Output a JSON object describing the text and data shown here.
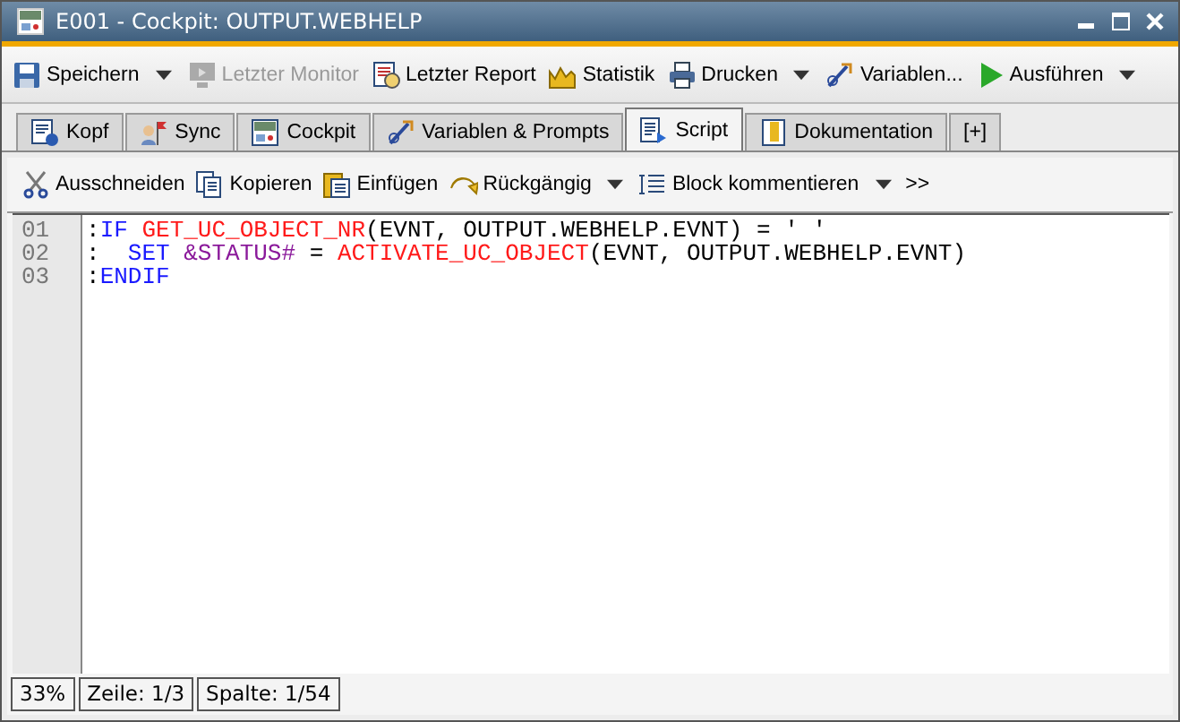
{
  "window": {
    "title": "E001 - Cockpit: OUTPUT.WEBHELP"
  },
  "toolbar": [
    {
      "label": "Speichern",
      "kind": "save",
      "disabled": false,
      "dropdown": true
    },
    {
      "label": "Letzter Monitor",
      "kind": "monitor",
      "disabled": true,
      "dropdown": false
    },
    {
      "label": "Letzter Report",
      "kind": "report",
      "disabled": false,
      "dropdown": false
    },
    {
      "label": "Statistik",
      "kind": "chart",
      "disabled": false,
      "dropdown": false
    },
    {
      "label": "Drucken",
      "kind": "print",
      "disabled": false,
      "dropdown": true
    },
    {
      "label": "Variablen...",
      "kind": "vars",
      "disabled": false,
      "dropdown": false
    },
    {
      "label": "Ausführen",
      "kind": "play",
      "disabled": false,
      "dropdown": true
    }
  ],
  "tabs": [
    {
      "label": "Kopf",
      "kind": "doc",
      "selected": false
    },
    {
      "label": "Sync",
      "kind": "flag",
      "selected": false
    },
    {
      "label": "Cockpit",
      "kind": "window",
      "selected": false
    },
    {
      "label": "Variablen & Prompts",
      "kind": "vars",
      "selected": false
    },
    {
      "label": "Script",
      "kind": "script",
      "selected": true
    },
    {
      "label": "Dokumentation",
      "kind": "book",
      "selected": false
    },
    {
      "label": "[+]",
      "kind": "text",
      "selected": false
    }
  ],
  "script_toolbar": [
    {
      "label": "Ausschneiden",
      "kind": "cut",
      "dropdown": false
    },
    {
      "label": "Kopieren",
      "kind": "copy",
      "dropdown": false
    },
    {
      "label": "Einfügen",
      "kind": "paste",
      "dropdown": false
    },
    {
      "label": "Rückgängig",
      "kind": "undo",
      "dropdown": true
    },
    {
      "label": "Block kommentieren",
      "kind": "comment",
      "dropdown": true
    },
    {
      "label": ">>",
      "kind": "text",
      "dropdown": false
    }
  ],
  "editor": {
    "lines": [
      {
        "number": "01",
        "segments": [
          {
            "kind": "plain",
            "text": ":"
          },
          {
            "kind": "keyword",
            "text": "IF "
          },
          {
            "kind": "function",
            "text": "GET_UC_OBJECT_NR"
          },
          {
            "kind": "plain",
            "text": "(EVNT, OUTPUT.WEBHELP.EVNT) = ' '"
          }
        ]
      },
      {
        "number": "02",
        "segments": [
          {
            "kind": "plain",
            "text": ":  "
          },
          {
            "kind": "keyword",
            "text": "SET "
          },
          {
            "kind": "variable",
            "text": "&STATUS#"
          },
          {
            "kind": "plain",
            "text": " = "
          },
          {
            "kind": "function",
            "text": "ACTIVATE_UC_OBJECT"
          },
          {
            "kind": "plain",
            "text": "(EVNT, OUTPUT.WEBHELP.EVNT)"
          }
        ]
      },
      {
        "number": "03",
        "segments": [
          {
            "kind": "plain",
            "text": ":"
          },
          {
            "kind": "keyword",
            "text": "ENDIF"
          }
        ]
      }
    ]
  },
  "status_bar": [
    "33%",
    "Zeile: 1/3",
    "Spalte: 1/54"
  ]
}
